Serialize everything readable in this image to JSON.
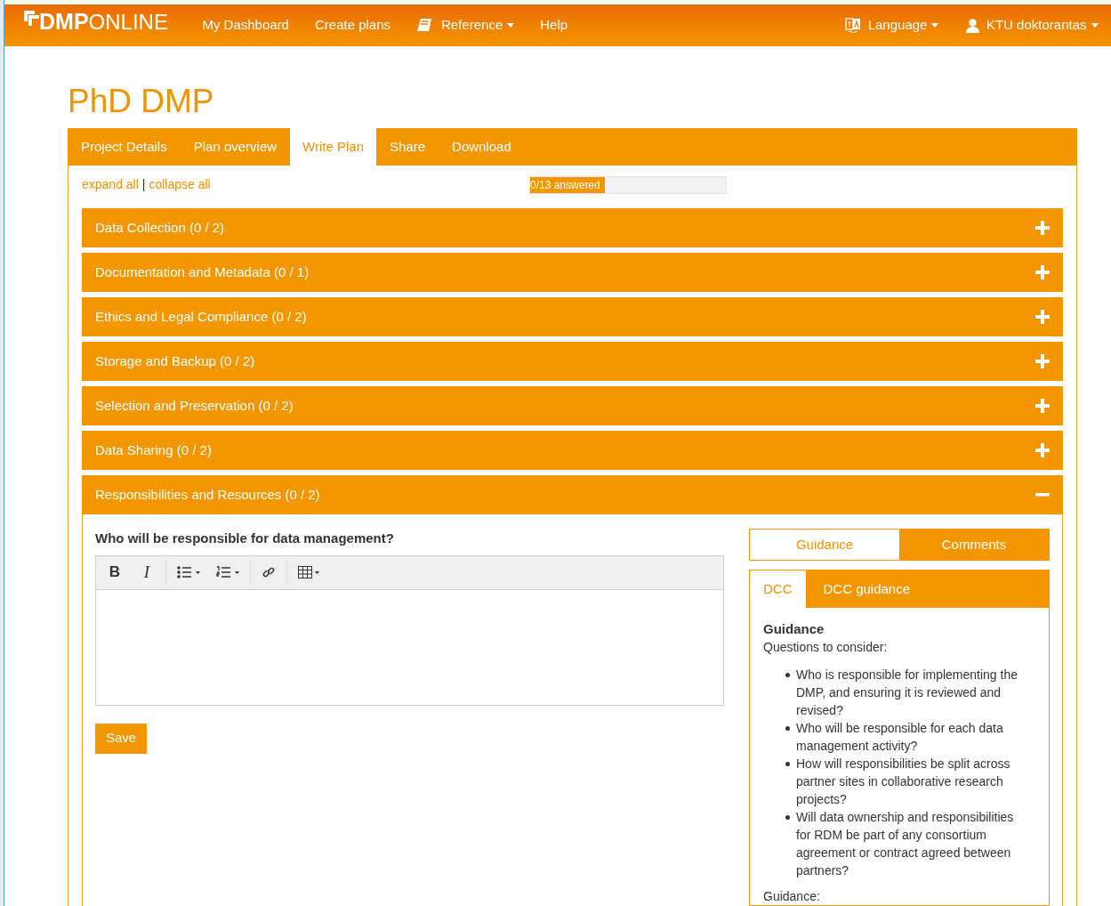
{
  "navbar": {
    "logo": {
      "bold": "DMP",
      "light": "ONLINE"
    },
    "items": [
      {
        "label": "My Dashboard",
        "kind": "link"
      },
      {
        "label": "Create plans",
        "kind": "link"
      },
      {
        "label": "Reference",
        "kind": "book-dropdown"
      },
      {
        "label": "Help",
        "kind": "link"
      }
    ],
    "right_items": [
      {
        "label": "Language",
        "kind": "language-dropdown"
      },
      {
        "label": "KTU doktorantas",
        "kind": "user-dropdown"
      }
    ]
  },
  "title": "PhD DMP",
  "tabs": [
    {
      "label": "Project Details",
      "selected": false
    },
    {
      "label": "Plan overview",
      "selected": false
    },
    {
      "label": "Write Plan",
      "selected": true
    },
    {
      "label": "Share",
      "selected": false
    },
    {
      "label": "Download",
      "selected": false
    }
  ],
  "toolbar": {
    "expand": "expand all",
    "separator": "|",
    "collapse": "collapse all"
  },
  "progress": {
    "label": "0/13 answered",
    "level": 0.38
  },
  "sections": [
    {
      "title": "Data Collection (0 / 2)",
      "expanded": false
    },
    {
      "title": "Documentation and Metadata (0 / 1)",
      "expanded": false
    },
    {
      "title": "Ethics and Legal Compliance (0 / 2)",
      "expanded": false
    },
    {
      "title": "Storage and Backup (0 / 2)",
      "expanded": false
    },
    {
      "title": "Selection and Preservation (0 / 2)",
      "expanded": false
    },
    {
      "title": "Data Sharing (0 / 2)",
      "expanded": false
    },
    {
      "title": "Responsibilities and Resources (0 / 2)",
      "expanded": true
    }
  ],
  "question": {
    "text": "Who will be responsible for data management?",
    "editor_tools": [
      {
        "kind": "bold",
        "label": "B"
      },
      {
        "kind": "italic",
        "label": "I"
      },
      {
        "kind": "bullets"
      },
      {
        "kind": "numbers"
      },
      {
        "kind": "link"
      },
      {
        "kind": "table"
      }
    ],
    "save": "Save"
  },
  "side_tabs": [
    {
      "label": "Guidance",
      "selected": true
    },
    {
      "label": "Comments",
      "selected": false
    }
  ],
  "guidance_tabs": [
    {
      "label": "DCC",
      "selected": true
    },
    {
      "label": "DCC guidance",
      "selected": false
    }
  ],
  "guidance": {
    "heading": "Guidance",
    "intro": "Questions to consider:",
    "bullets": [
      "Who is responsible for implementing the DMP, and ensuring it is reviewed and revised?",
      "Who will be responsible for each data management activity?",
      "How will responsibilities be split across partner sites in collaborative research projects?",
      "Will data ownership and responsibilities for RDM be part of any consortium agreement or contract agreed between partners?"
    ],
    "footer": "Guidance:"
  }
}
